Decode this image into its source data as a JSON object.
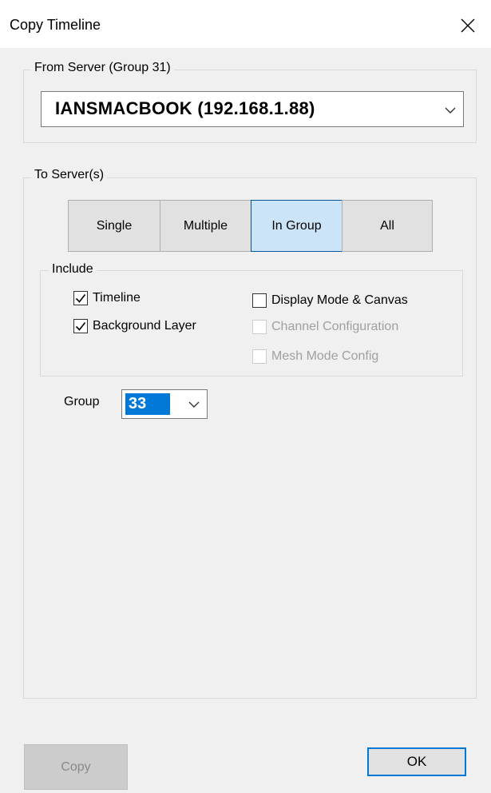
{
  "window": {
    "title": "Copy Timeline"
  },
  "from_server": {
    "legend": "From Server  (Group 31)",
    "selected": "IANSMACBOOK  (192.168.1.88)"
  },
  "to_servers": {
    "legend": "To Server(s)",
    "modes": [
      {
        "label": "Single",
        "active": false
      },
      {
        "label": "Multiple",
        "active": false
      },
      {
        "label": "In Group",
        "active": true
      },
      {
        "label": "All",
        "active": false
      }
    ],
    "include": {
      "legend": "Include",
      "options": [
        {
          "label": "Timeline",
          "checked": true,
          "enabled": true
        },
        {
          "label": "Background Layer",
          "checked": true,
          "enabled": true
        },
        {
          "label": "Display Mode & Canvas",
          "checked": false,
          "enabled": true
        },
        {
          "label": "Channel Configuration",
          "checked": false,
          "enabled": false
        },
        {
          "label": "Mesh Mode Config",
          "checked": false,
          "enabled": false
        }
      ]
    },
    "group": {
      "label": "Group",
      "value": "33"
    }
  },
  "buttons": {
    "copy": "Copy",
    "ok": "OK"
  },
  "colors": {
    "accent": "#0078d7",
    "active_segment": "#cce4f7",
    "background": "#f0f0f0"
  }
}
